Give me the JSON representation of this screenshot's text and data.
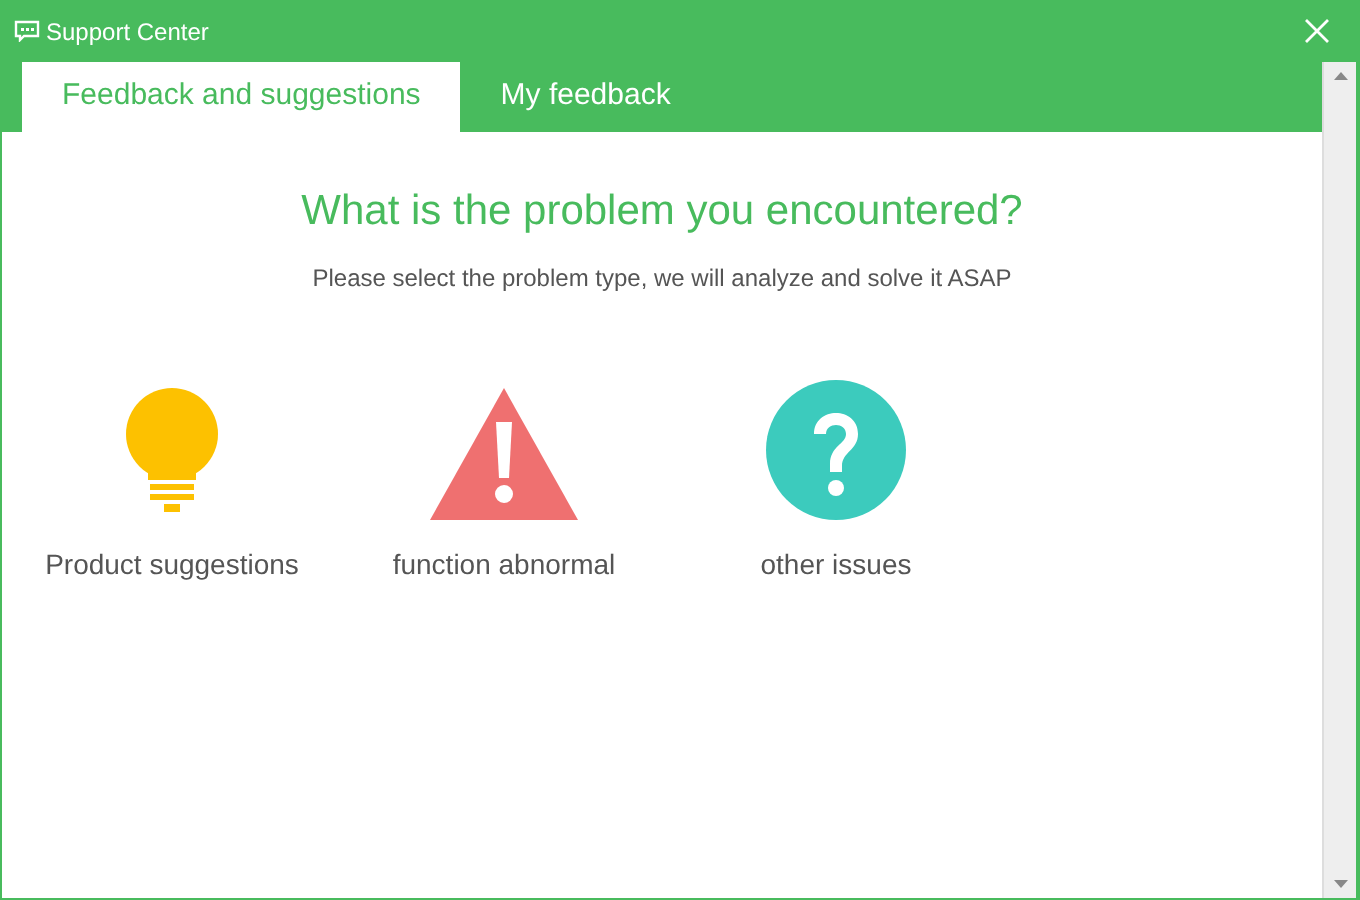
{
  "window": {
    "title": "Support Center"
  },
  "tabs": [
    {
      "label": "Feedback and suggestions",
      "selected": true
    },
    {
      "label": "My feedback",
      "selected": false
    }
  ],
  "heading": "What is the problem you encountered?",
  "subheading": "Please select the problem type, we will analyze and solve it ASAP",
  "options": [
    {
      "kind": "bulb",
      "label": "Product suggestions"
    },
    {
      "kind": "warning",
      "label": "function abnormal"
    },
    {
      "kind": "question",
      "label": "other issues"
    }
  ]
}
